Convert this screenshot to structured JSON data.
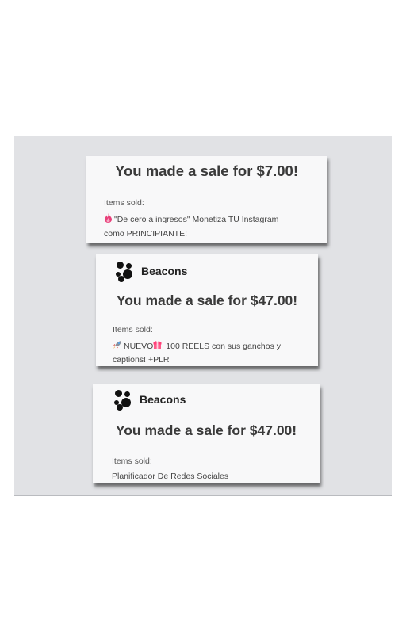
{
  "notifications": [
    {
      "brand": "",
      "headline": "You made a sale for $7.00!",
      "items_label": "Items sold:",
      "item_icon": "fire-icon",
      "item_lines": [
        "\"De cero a ingresos\" Monetiza TU Instagram",
        "como PRINCIPIANTE!"
      ]
    },
    {
      "brand": "Beacons",
      "headline": "You made a sale for $47.00!",
      "items_label": "Items sold:",
      "item_icons": [
        "rocket-icon",
        "gift-icon"
      ],
      "item_lines": [
        "NUEVO",
        " 100 REELS con sus ganchos y",
        "captions! +PLR"
      ]
    },
    {
      "brand": "Beacons",
      "headline": "You made a sale for $47.00!",
      "items_label": "Items sold:",
      "item_lines": [
        "Planificador De Redes Sociales"
      ]
    }
  ],
  "colors": {
    "panel": "#e1e2e5",
    "card": "#f8f8f9",
    "text": "#3a3a3a",
    "fire": "#e8407a"
  }
}
